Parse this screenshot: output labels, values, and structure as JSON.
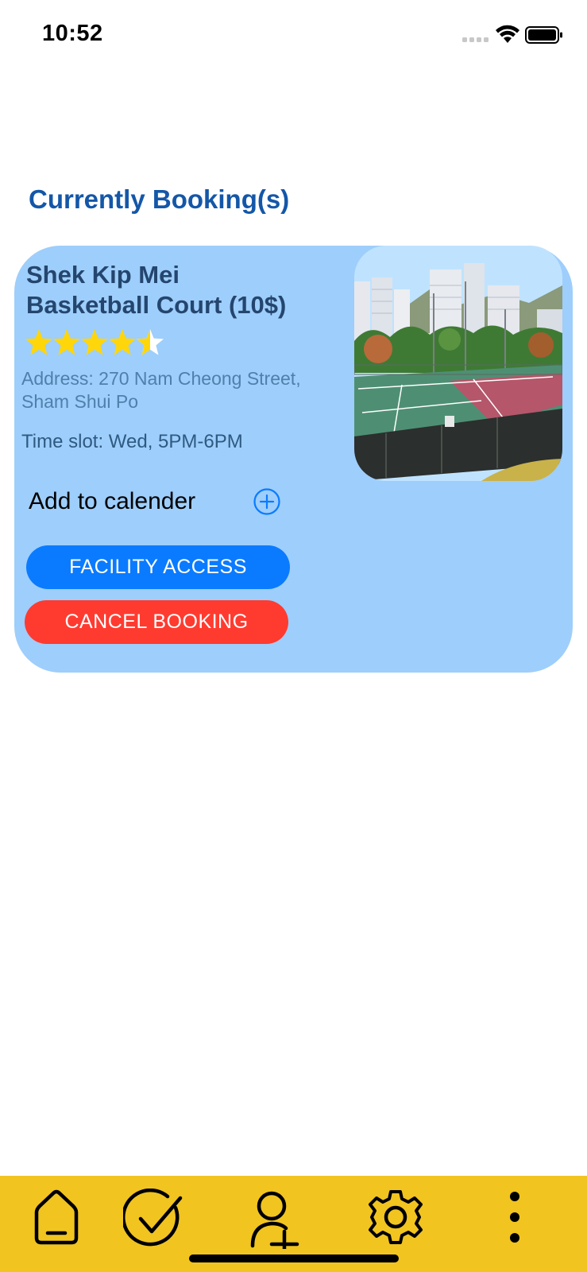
{
  "status_bar": {
    "time": "10:52"
  },
  "section": {
    "title": "Currently Booking(s)"
  },
  "booking": {
    "court_name": "Shek Kip Mei\nBasketball Court (10$)",
    "rating": 4.5,
    "rating_max": 5,
    "address": "Address: 270 Nam Cheong Street, Sham Shui Po",
    "timeslot": "Time slot: Wed, 5PM-6PM",
    "calendar_label": "Add to calender",
    "facility_access_label": "FACILITY ACCESS",
    "cancel_label": "CANCEL BOOKING"
  },
  "tabbar": {
    "items": [
      {
        "icon": "home-icon"
      },
      {
        "icon": "checkmark-icon"
      },
      {
        "icon": "add-user-icon"
      },
      {
        "icon": "gear-icon"
      },
      {
        "icon": "more-vertical-icon"
      }
    ]
  },
  "colors": {
    "title": "#1457a8",
    "card": "#9ecefb",
    "access_button": "#0a7bff",
    "cancel_button": "#ff3b30",
    "tabbar": "#f1c41f",
    "star": "#ffd60a"
  }
}
